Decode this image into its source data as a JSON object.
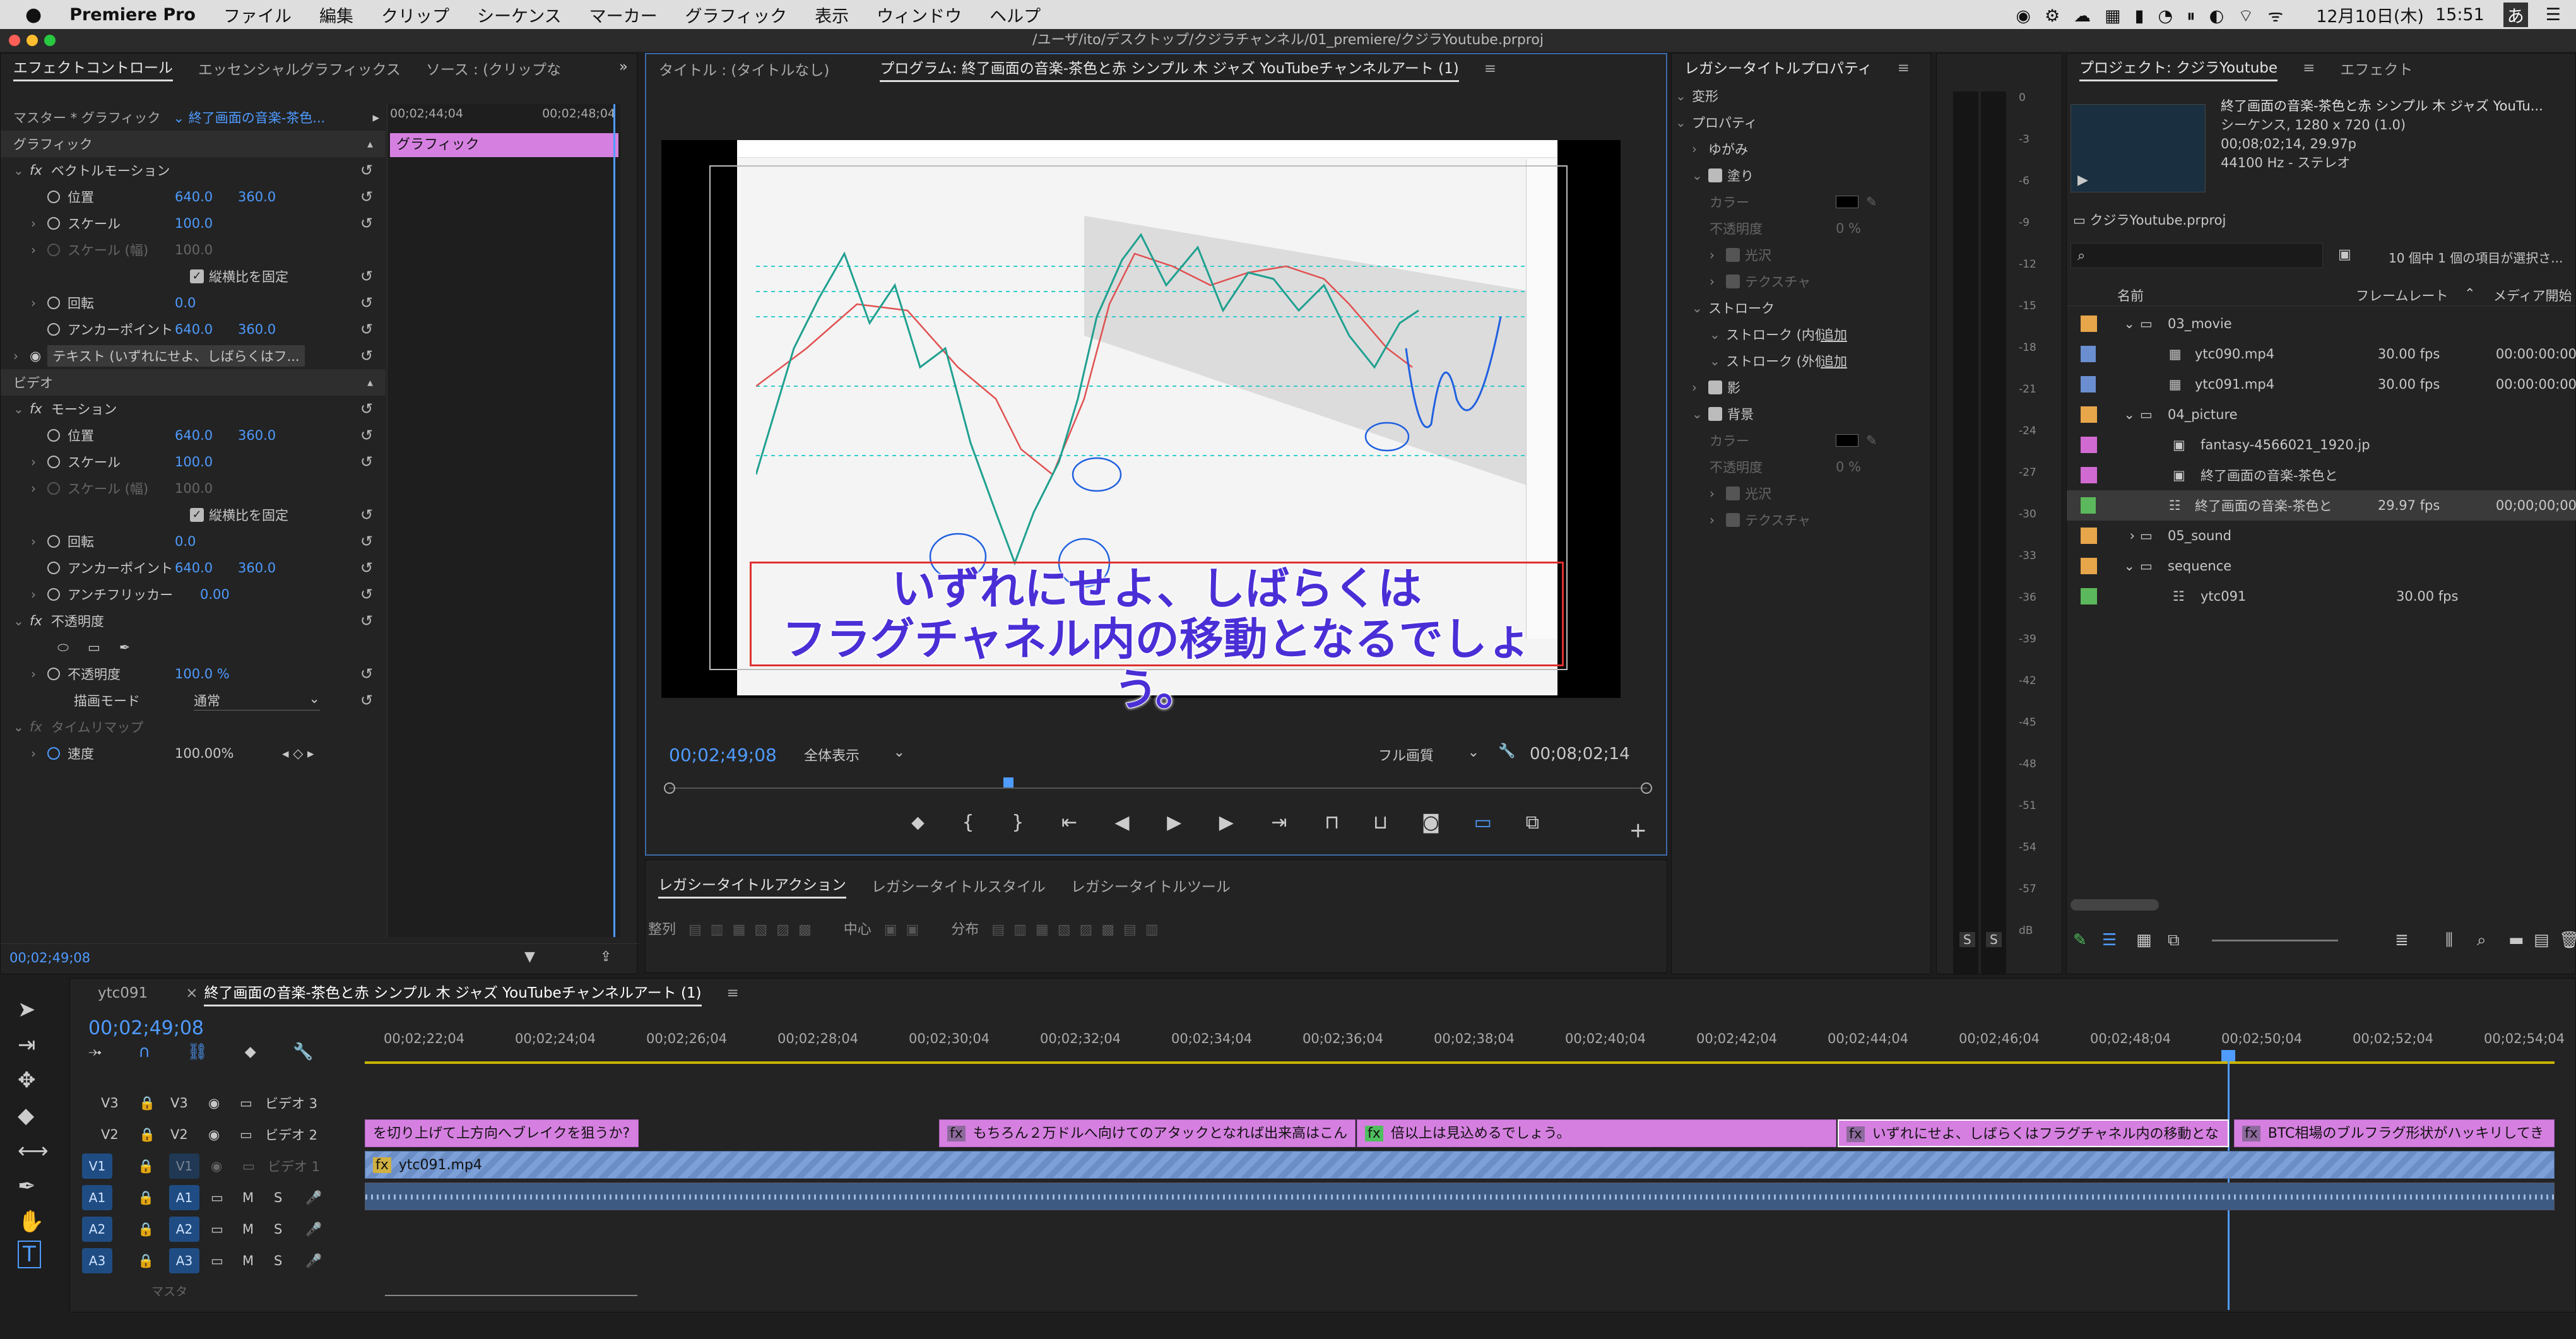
{
  "menubar": {
    "apple": "",
    "app": "Premiere Pro",
    "items": [
      "ファイル",
      "編集",
      "クリップ",
      "シーケンス",
      "マーカー",
      "グラフィック",
      "表示",
      "ウィンドウ",
      "ヘルプ"
    ],
    "date": "12月10日(木)",
    "time": "15:51",
    "ime": "あ"
  },
  "window": {
    "path": "/ユーザ/ito/デスクトップ/クジラチャンネル/01_premiere/クジラYoutube.prproj"
  },
  "effects": {
    "tabs": [
      "エフェクトコントロール",
      "エッセンシャルグラフィックス",
      "ソース : (クリップな"
    ],
    "master_label": "マスター * グラフィック",
    "master_value": "終了画面の音楽-茶色...",
    "tc_start": "00;02;44;04",
    "tc_end": "00;02;48;04",
    "clip_label": "グラフィック",
    "section_graphic": "グラフィック",
    "vector_motion": "ベクトルモーション",
    "position_label": "位置",
    "pos_x": "640.0",
    "pos_y": "360.0",
    "scale_label": "スケール",
    "scale_val": "100.0",
    "scale_w_label": "スケール (幅)",
    "scale_w_val": "100.0",
    "lock_ratio": "縦横比を固定",
    "rotation_label": "回転",
    "rotation_val": "0.0",
    "anchor_label": "アンカーポイント",
    "anchor_x": "640.0",
    "anchor_y": "360.0",
    "text_layer": "テキスト (いずれにせよ、しばらくはフ...",
    "section_video": "ビデオ",
    "motion": "モーション",
    "antiflicker_label": "アンチフリッカー",
    "antiflicker_val": "0.00",
    "opacity_section": "不透明度",
    "opacity_label": "不透明度",
    "opacity_val": "100.0 %",
    "blend_label": "描画モード",
    "blend_val": "通常",
    "timeremap": "タイムリマップ",
    "speed_label": "速度",
    "speed_val": "100.00%",
    "bottom_tc": "00;02;49;08"
  },
  "program": {
    "tabs": [
      "タイトル : (タイトルなし)",
      "プログラム: 終了画面の音楽-茶色と赤 シンプル 木 ジャズ YouTubeチャンネルアート (1)"
    ],
    "caption_line1": "いずれにせよ、しばらくは",
    "caption_line2": "フラグチャネル内の移動となるでしょう。",
    "tc_current": "00;02;49;08",
    "fit": "全体表示",
    "quality": "フル画質",
    "tc_duration": "00;08;02;14"
  },
  "legacy_props": {
    "title": "レガシータイトルプロパティ",
    "items": [
      "変形",
      "プロパティ",
      "ゆがみ",
      "塗り",
      "カラー",
      "不透明度",
      "光沢",
      "テクスチャ",
      "ストローク",
      "ストローク (内側)",
      "ストローク (外側)",
      "影",
      "背景",
      "カラー",
      "不透明度",
      "光沢",
      "テクスチャ"
    ],
    "add": "追加",
    "pct": "0 %"
  },
  "legacy_actions": {
    "tabs": [
      "レガシータイトルアクション",
      "レガシータイトルスタイル",
      "レガシータイトルツール"
    ],
    "align": "整列",
    "center": "中心",
    "distribute": "分布"
  },
  "meter": {
    "ticks": [
      "0",
      "-3",
      "-6",
      "-9",
      "-12",
      "-15",
      "-18",
      "-21",
      "-24",
      "-27",
      "-30",
      "-33",
      "-36",
      "-39",
      "-42",
      "-45",
      "-48",
      "-51",
      "-54",
      "-57",
      "dB"
    ],
    "solo": [
      "S",
      "S"
    ]
  },
  "project": {
    "tabs": [
      "プロジェクト: クジラYoutube",
      "エフェクト"
    ],
    "seq_name": "終了画面の音楽-茶色と赤 シンプル 木 ジャズ YouTu...",
    "seq_type": "シーケンス, 1280 x 720 (1.0)",
    "seq_dur": "00;08;02;14, 29.97p",
    "seq_audio": "44100 Hz - ステレオ",
    "proj_file": "クジラYoutube.prproj",
    "item_count": "10 個中 1 個の項目が選択さ...",
    "cols": [
      "名前",
      "フレームレート",
      "メディア開始"
    ],
    "rows": [
      {
        "name": "03_movie",
        "fps": "",
        "start": "",
        "color": "#e8a64a",
        "indent": 0,
        "type": "folder"
      },
      {
        "name": "ytc090.mp4",
        "fps": "30.00 fps",
        "start": "00:00:00:00",
        "color": "#6a8ed0",
        "indent": 1,
        "type": "video"
      },
      {
        "name": "ytc091.mp4",
        "fps": "30.00 fps",
        "start": "00:00:00:00",
        "color": "#6a8ed0",
        "indent": 1,
        "type": "video"
      },
      {
        "name": "04_picture",
        "fps": "",
        "start": "",
        "color": "#e8a64a",
        "indent": 0,
        "type": "folder"
      },
      {
        "name": "fantasy-4566021_1920.jp",
        "fps": "",
        "start": "",
        "color": "#d06ad0",
        "indent": 1,
        "type": "image"
      },
      {
        "name": "終了画面の音楽-茶色と",
        "fps": "",
        "start": "",
        "color": "#d06ad0",
        "indent": 1,
        "type": "image"
      },
      {
        "name": "終了画面の音楽-茶色と",
        "fps": "29.97 fps",
        "start": "00;00;00;00",
        "color": "#5cb85c",
        "indent": 1,
        "type": "seq"
      },
      {
        "name": "05_sound",
        "fps": "",
        "start": "",
        "color": "#e8a64a",
        "indent": 0,
        "type": "folder"
      },
      {
        "name": "sequence",
        "fps": "",
        "start": "",
        "color": "#e8a64a",
        "indent": 0,
        "type": "folder"
      },
      {
        "name": "ytc091",
        "fps": "30.00 fps",
        "start": "",
        "color": "#5cb85c",
        "indent": 1,
        "type": "seq"
      }
    ]
  },
  "timeline": {
    "tabs": [
      "ytc091",
      "終了画面の音楽-茶色と赤 シンプル 木 ジャズ YouTubeチャンネルアート (1)"
    ],
    "tc": "00;02;49;08",
    "ruler": [
      "00;02;22;04",
      "00;02;24;04",
      "00;02;26;04",
      "00;02;28;04",
      "00;02;30;04",
      "00;02;32;04",
      "00;02;34;04",
      "00;02;36;04",
      "00;02;38;04",
      "00;02;40;04",
      "00;02;42;04",
      "00;02;44;04",
      "00;02;46;04",
      "00;02;48;04",
      "00;02;50;04",
      "00;02;52;04",
      "00;02;54;04"
    ],
    "tracks": [
      {
        "id": "V3",
        "name": "ビデオ 3"
      },
      {
        "id": "V2",
        "name": "ビデオ 2"
      },
      {
        "id": "V1",
        "name": "ビデオ 1"
      },
      {
        "id": "A1",
        "name": ""
      },
      {
        "id": "A2",
        "name": ""
      },
      {
        "id": "A3",
        "name": ""
      }
    ],
    "clips_v2": [
      "を切り上げて上方向へブレイクを狙うか?",
      "もちろん２万ドルへ向けてのアタックとなれば出来高はこん",
      "倍以上は見込めるでしょう。",
      "いずれにせよ、しばらくはフラグチャネル内の移動とな",
      "BTC相場のブルフラグ形状がハッキリしてき"
    ],
    "clip_v1": "ytc091.mp4",
    "mix": "マスタ"
  },
  "colors": {
    "accent": "#4f9bff",
    "caption": "#4a2fd6",
    "clip_pink": "#d580e0",
    "clip_blue": "#7da0d8"
  }
}
